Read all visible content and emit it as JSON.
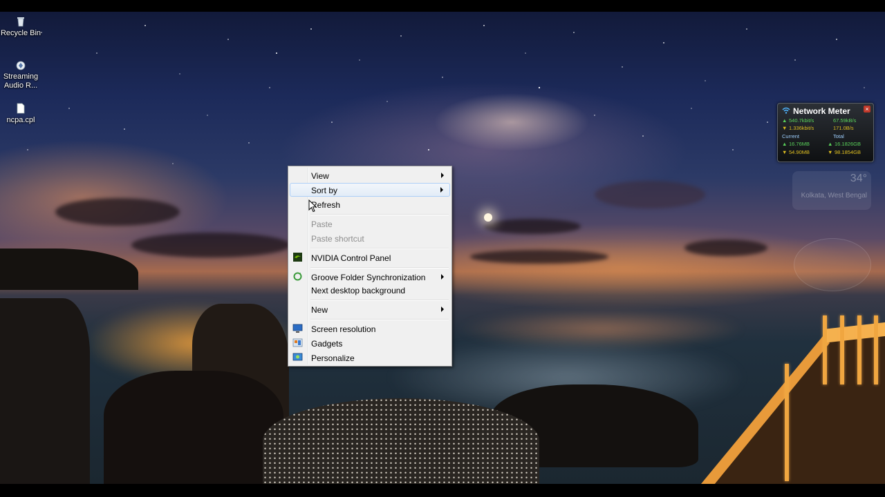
{
  "desktop": {
    "icons": [
      {
        "label": "Recycle Bin",
        "icon": "recycle-bin-icon"
      },
      {
        "label": "Streaming Audio R...",
        "icon": "audio-icon"
      },
      {
        "label": "ncpa.cpl",
        "icon": "file-icon"
      }
    ]
  },
  "network_meter": {
    "title": "Network Meter",
    "row1_left": "540.7kbit/s",
    "row1_right": "67.59kB/s",
    "row2_left": "1.336kbit/s",
    "row2_right": "171.0B/s",
    "current_label": "Current",
    "total_label": "Total",
    "cur_up": "16.76MB",
    "total_up": "16.1826GB",
    "cur_down": "54.90MB",
    "total_down": "98.1854GB"
  },
  "weather": {
    "temperature": "34°",
    "location": "Kolkata, West Bengal"
  },
  "context_menu": {
    "view": "View",
    "sort_by": "Sort by",
    "refresh": "Refresh",
    "paste": "Paste",
    "paste_shortcut": "Paste shortcut",
    "nvidia": "NVIDIA Control Panel",
    "groove": "Groove Folder Synchronization",
    "next_bg": "Next desktop background",
    "new": "New",
    "screen_resolution": "Screen resolution",
    "gadgets": "Gadgets",
    "personalize": "Personalize",
    "hovered_item": "Sort by"
  }
}
